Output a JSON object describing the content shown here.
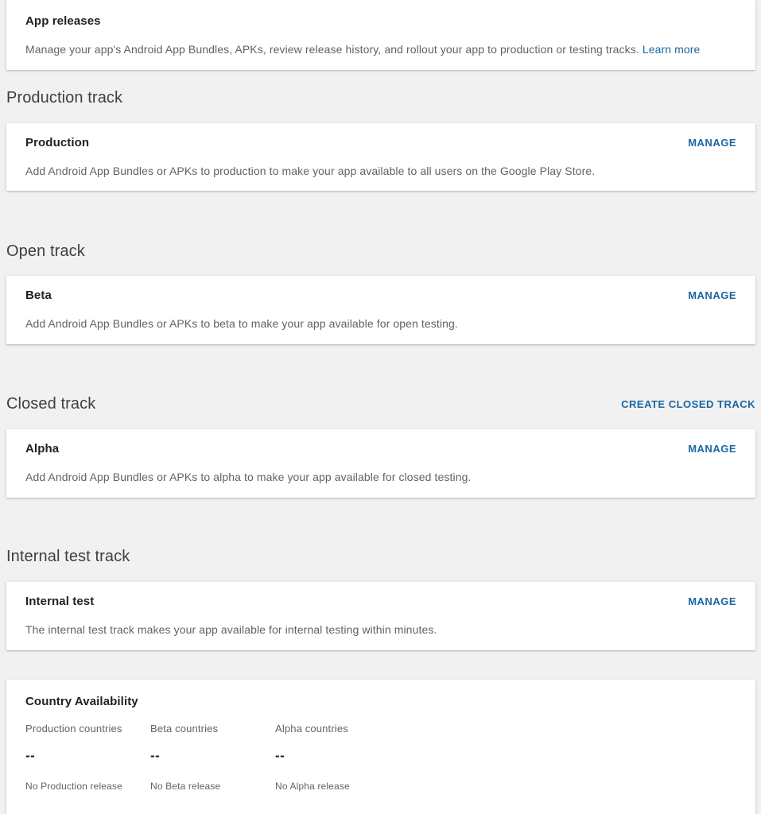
{
  "colors": {
    "page_background": "#f1f1f1",
    "card_background": "#ffffff",
    "link_blue": "#1a67a3",
    "heading_text": "#3c4043",
    "title_text": "#202124",
    "body_text": "#5f6368"
  },
  "app_releases": {
    "title": "App releases",
    "description": "Manage your app's Android App Bundles, APKs, review release history, and rollout your app to production or testing tracks.",
    "learn_more_label": "Learn more"
  },
  "sections": [
    {
      "heading": "Production track",
      "action_label": null,
      "card": {
        "title": "Production",
        "manage_label": "MANAGE",
        "description": "Add Android App Bundles or APKs to production to make your app available to all users on the Google Play Store."
      }
    },
    {
      "heading": "Open track",
      "action_label": null,
      "card": {
        "title": "Beta",
        "manage_label": "MANAGE",
        "description": "Add Android App Bundles or APKs to beta to make your app available for open testing."
      }
    },
    {
      "heading": "Closed track",
      "action_label": "CREATE CLOSED TRACK",
      "card": {
        "title": "Alpha",
        "manage_label": "MANAGE",
        "description": "Add Android App Bundles or APKs to alpha to make your app available for closed testing."
      }
    },
    {
      "heading": "Internal test track",
      "action_label": null,
      "card": {
        "title": "Internal test",
        "manage_label": "MANAGE",
        "description": "The internal test track makes your app available for internal testing within minutes."
      }
    }
  ],
  "country_availability": {
    "title": "Country Availability",
    "columns": [
      {
        "label": "Production countries",
        "value": "--",
        "note": "No Production release"
      },
      {
        "label": "Beta countries",
        "value": "--",
        "note": "No Beta release"
      },
      {
        "label": "Alpha countries",
        "value": "--",
        "note": "No Alpha release"
      }
    ]
  }
}
